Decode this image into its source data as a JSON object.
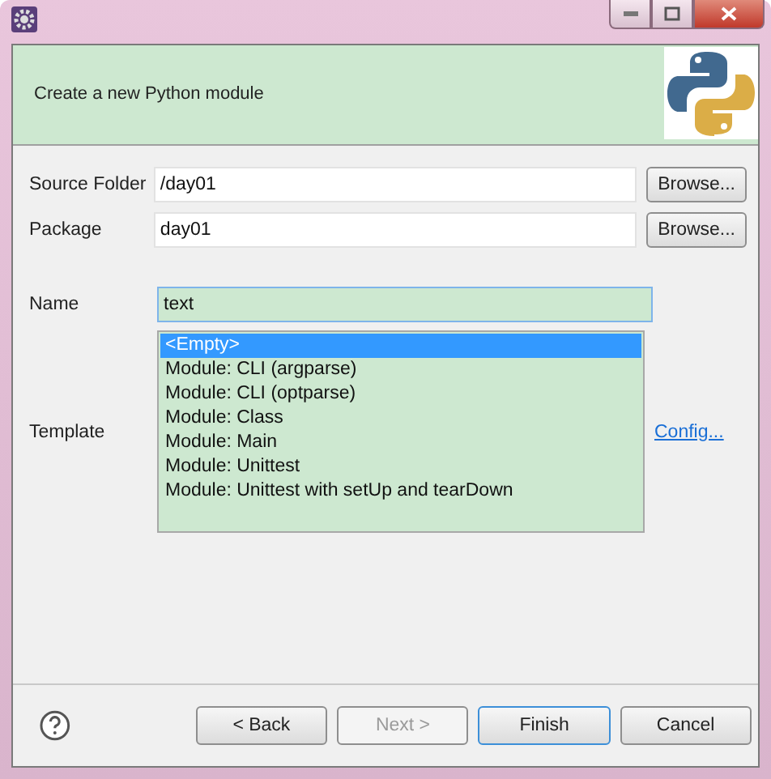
{
  "header": {
    "description": "Create a new Python module"
  },
  "fields": [
    {
      "label": "Source Folder",
      "value": "/day01",
      "button": "Browse..."
    },
    {
      "label": "Package",
      "value": "day01",
      "button": "Browse..."
    },
    {
      "label": "Name",
      "value": "text"
    }
  ],
  "template": {
    "label": "Template",
    "link": "Config...",
    "items": [
      {
        "label": "<Empty>",
        "selected": true
      },
      {
        "label": "Module: CLI (argparse)",
        "selected": false
      },
      {
        "label": "Module: CLI (optparse)",
        "selected": false
      },
      {
        "label": "Module: Class",
        "selected": false
      },
      {
        "label": "Module: Main",
        "selected": false
      },
      {
        "label": "Module: Unittest",
        "selected": false
      },
      {
        "label": "Module: Unittest with setUp and tearDown",
        "selected": false
      }
    ]
  },
  "buttons": [
    {
      "label": "< Back",
      "disabled": false,
      "default": false
    },
    {
      "label": "Next >",
      "disabled": true,
      "default": false
    },
    {
      "label": "Finish",
      "disabled": false,
      "default": true
    },
    {
      "label": "Cancel",
      "disabled": false,
      "default": false
    }
  ]
}
